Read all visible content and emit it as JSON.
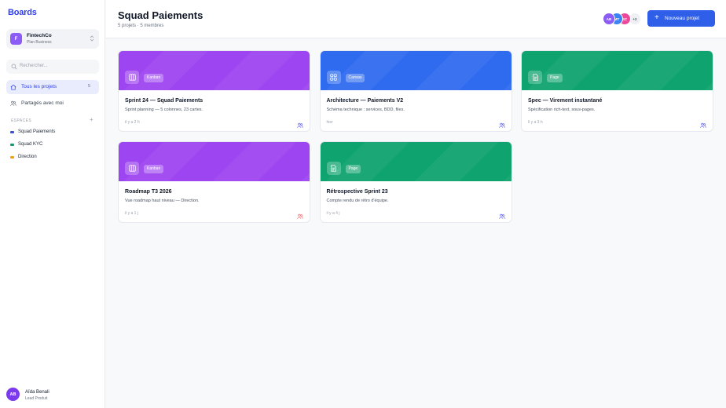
{
  "app": {
    "brand": "Boards"
  },
  "workspace": {
    "initial": "F",
    "name": "FintechCo",
    "plan": "Plan Business"
  },
  "search": {
    "placeholder": "Rechercher..."
  },
  "nav": {
    "all_projects": {
      "label": "Tous les projets",
      "count": "5"
    },
    "shared": {
      "label": "Partagés avec moi"
    }
  },
  "spaces": {
    "title": "ESPACES",
    "add": "+",
    "items": [
      {
        "label": "Squad Paiements",
        "color": "#3b4fe0"
      },
      {
        "label": "Squad KYC",
        "color": "#0e9f6e"
      },
      {
        "label": "Direction",
        "color": "#f59e0b"
      }
    ]
  },
  "user": {
    "initials": "AB",
    "name": "Aïda Benali",
    "role": "Lead Produit"
  },
  "header": {
    "title": "Squad Paiements",
    "subtitle": "5 projets · 5 membres",
    "members": [
      {
        "initials": "AB",
        "color": "#8b5cf6"
      },
      {
        "initials": "MT",
        "color": "#3b82f6"
      },
      {
        "initials": "SC",
        "color": "#ec4899"
      }
    ],
    "members_more": "+2",
    "new_button": "Nouveau projet"
  },
  "projects": [
    {
      "type": "Kanban",
      "icon": "kanban-icon",
      "color": "#9d45f0",
      "title": "Sprint 24 — Squad Paiements",
      "description": "Sprint planning — 5 colonnes, 23 cartes.",
      "time": "il y a 2 h",
      "share_color": "#6366f1"
    },
    {
      "type": "Canvas",
      "icon": "canvas-icon",
      "color": "#2f6bef",
      "title": "Architecture — Paiements V2",
      "description": "Schéma technique : services, BDD, files.",
      "time": "hier",
      "share_color": "#6366f1"
    },
    {
      "type": "Page",
      "icon": "page-icon",
      "color": "#0fa36f",
      "title": "Spec — Virement instantané",
      "description": "Spécification rich-text, sous-pages.",
      "time": "il y a 3 h",
      "share_color": "#6366f1"
    },
    {
      "type": "Kanban",
      "icon": "kanban-icon",
      "color": "#9d45f0",
      "title": "Roadmap T3 2026",
      "description": "Vue roadmap haut niveau — Direction.",
      "time": "il y a 1 j",
      "share_color": "#f87171"
    },
    {
      "type": "Page",
      "icon": "page-icon",
      "color": "#0fa36f",
      "title": "Rétrospective Sprint 23",
      "description": "Compte rendu de rétro d'équipe.",
      "time": "il y a 4 j",
      "share_color": "#6366f1"
    }
  ]
}
